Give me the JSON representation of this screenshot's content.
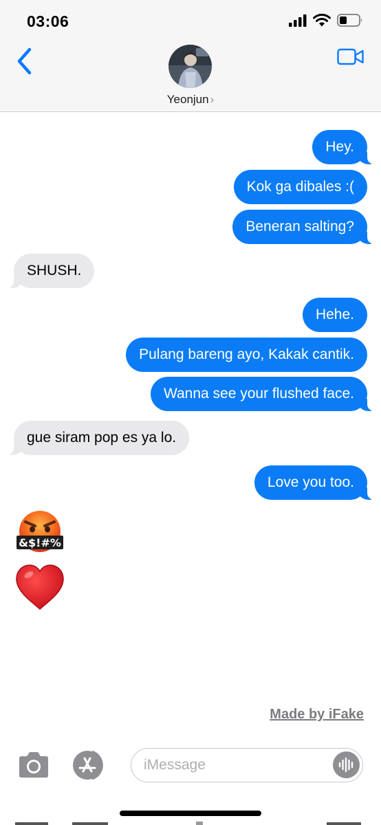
{
  "status_bar": {
    "time": "03:06"
  },
  "header": {
    "contact_name": "Yeonjun",
    "chevron": "›"
  },
  "messages": [
    {
      "from": "me",
      "text": "Hey."
    },
    {
      "from": "me",
      "text": "Kok ga dibales :("
    },
    {
      "from": "me",
      "text": "Beneran salting?"
    },
    {
      "from": "them",
      "text": "SHUSH."
    },
    {
      "from": "me",
      "text": "Hehe."
    },
    {
      "from": "me",
      "text": "Pulang bareng ayo, Kakak cantik."
    },
    {
      "from": "me",
      "text": "Wanna see your flushed face."
    },
    {
      "from": "them",
      "text": "gue siram pop es ya lo."
    },
    {
      "from": "me",
      "text": "Love you too."
    }
  ],
  "emojis": [
    {
      "name": "face-with-symbols-on-mouth-emoji",
      "caption": "&$!#%"
    },
    {
      "name": "red-heart-emoji"
    }
  ],
  "watermark": "Made by iFake",
  "composer": {
    "placeholder": "iMessage"
  },
  "colors": {
    "outgoing": "#0b7cf5",
    "incoming": "#e9e9eb",
    "accent": "#0a7aff"
  }
}
